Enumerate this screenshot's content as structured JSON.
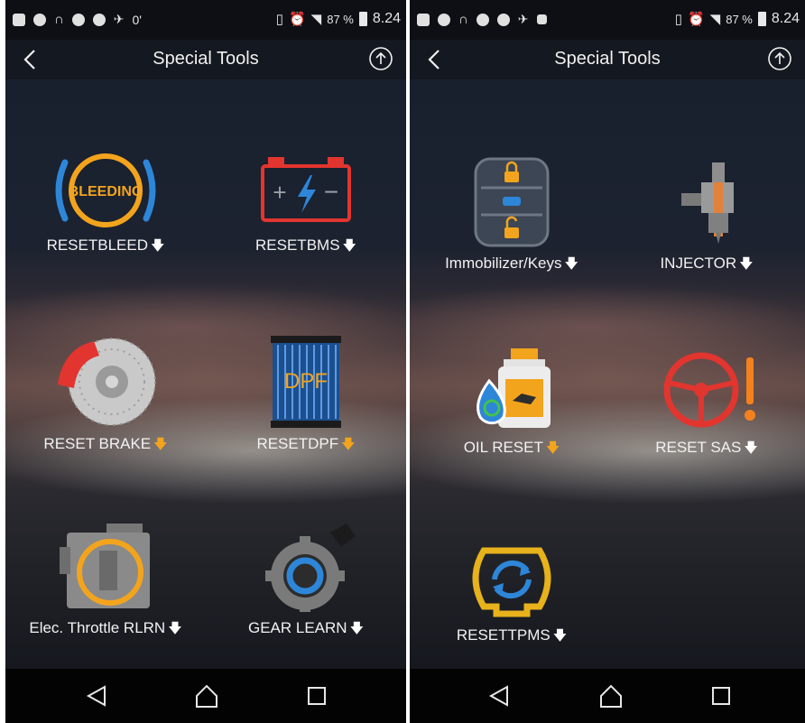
{
  "left": {
    "status": {
      "misc": "0'",
      "battery": "87 %",
      "time": "8.24"
    },
    "title": "Special Tools",
    "tools": [
      {
        "label": "RESETBLEED",
        "arrow": "🡇",
        "icon_text": "BLEEDING"
      },
      {
        "label": "RESETBMS",
        "arrow": "🡇"
      },
      {
        "label": "RESET BRAKE",
        "arrow": "🡇"
      },
      {
        "label": "RESETDPF",
        "arrow": "🡇",
        "icon_text": "DPF"
      },
      {
        "label": "Elec. Throttle RLRN",
        "arrow": "🡇"
      },
      {
        "label": "GEAR LEARN",
        "arrow": "🡇"
      }
    ]
  },
  "right": {
    "status": {
      "battery": "87 %",
      "time": "8.24"
    },
    "title": "Special Tools",
    "tools": [
      {
        "label": "Immobilizer/Keys",
        "arrow": "🡇"
      },
      {
        "label": "INJECTOR",
        "arrow": "🡇"
      },
      {
        "label": "OIL RESET",
        "arrow": "🡇"
      },
      {
        "label": "RESET SAS",
        "arrow": "🡇"
      },
      {
        "label": "RESETTPMS",
        "arrow": "🡇"
      }
    ]
  },
  "icons": {
    "back": "chevron-left-icon",
    "upload": "circle-up-arrow-icon",
    "nav_back": "triangle-back-icon",
    "nav_home": "home-outline-icon",
    "nav_recents": "square-recents-icon"
  },
  "colors": {
    "accent_orange": "#f3a41d",
    "accent_blue": "#2d86d8",
    "alert_red": "#e2352f",
    "background": "#12151c"
  }
}
